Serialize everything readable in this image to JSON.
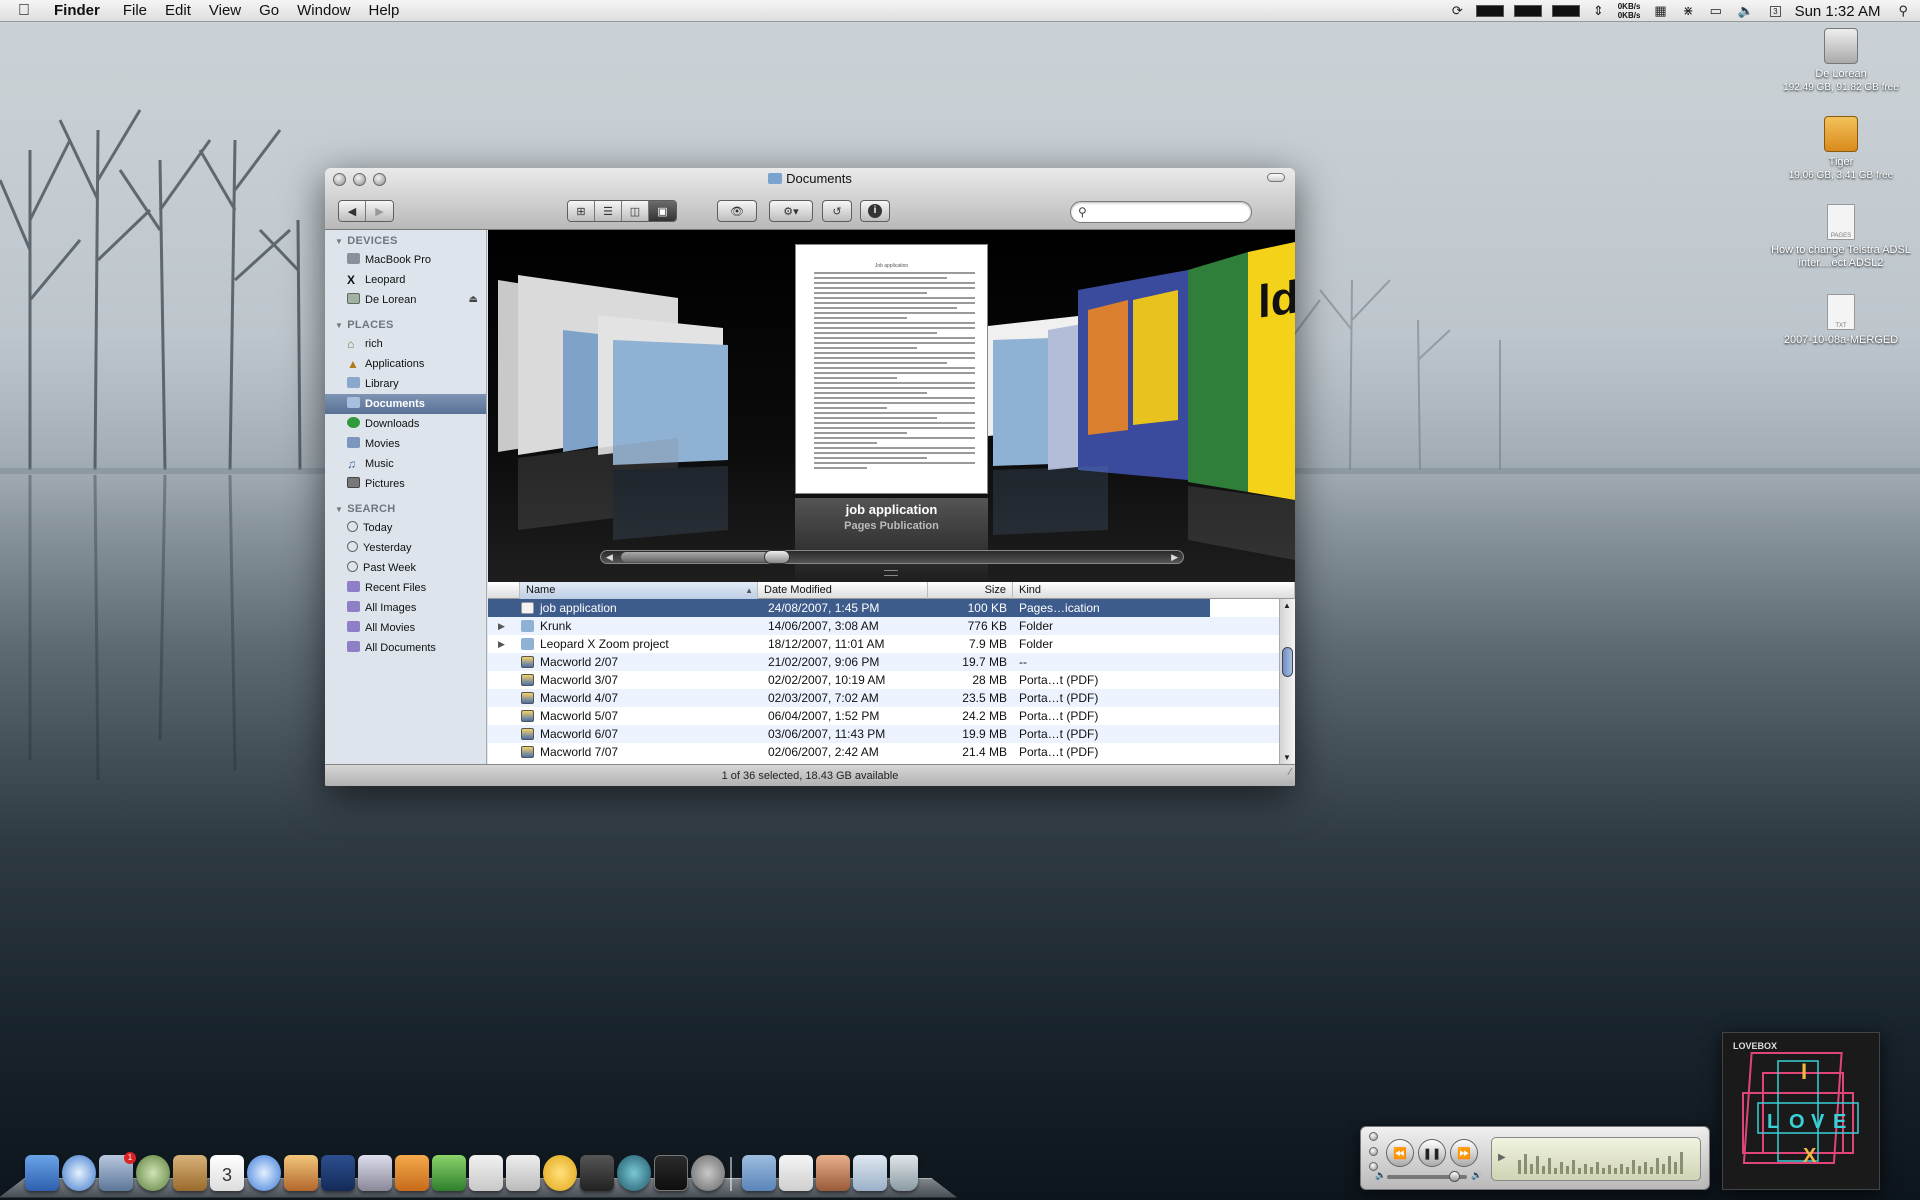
{
  "menubar": {
    "app_name": "Finder",
    "menus": [
      "File",
      "Edit",
      "View",
      "Go",
      "Window",
      "Help"
    ],
    "net_up": "0KB/s",
    "net_down": "0KB/s",
    "calendar_day": "3",
    "clock": "Sun 1:32 AM"
  },
  "desktop_icons": [
    {
      "name": "De Lorean",
      "sub": "192.49 GB, 91.82 GB free"
    },
    {
      "name": "Tiger",
      "sub": "19.06 GB, 3.41 GB free"
    },
    {
      "name": "How to change Telstra ADSL inter....ect ADSL2",
      "badge": "PAGES"
    },
    {
      "name": "2007-10-08a-MERGED",
      "badge": "TXT"
    }
  ],
  "window": {
    "title": "Documents",
    "search_placeholder": "",
    "status": "1 of 36 selected, 18.43 GB available"
  },
  "sidebar": {
    "devices_label": "DEVICES",
    "devices": [
      "MacBook Pro",
      "Leopard",
      "De Lorean"
    ],
    "places_label": "PLACES",
    "places": [
      "rich",
      "Applications",
      "Library",
      "Documents",
      "Downloads",
      "Movies",
      "Music",
      "Pictures"
    ],
    "search_label": "SEARCH",
    "searches": [
      "Today",
      "Yesterday",
      "Past Week",
      "Recent Files",
      "All Images",
      "All Movies",
      "All Documents"
    ],
    "selected": "Documents"
  },
  "coverflow": {
    "name": "job application",
    "kind": "Pages Publication",
    "doc_heading": "Job application",
    "right_cover_text": "ldd"
  },
  "list": {
    "columns": [
      "Name",
      "Date Modified",
      "Size",
      "Kind"
    ],
    "rows": [
      {
        "name": "job application",
        "date": "24/08/2007, 1:45 PM",
        "size": "100 KB",
        "kind": "Pages…ication",
        "selected": true,
        "folder": false,
        "expand": false
      },
      {
        "name": "Krunk",
        "date": "14/06/2007, 3:08 AM",
        "size": "776 KB",
        "kind": "Folder",
        "selected": false,
        "folder": true,
        "expand": true
      },
      {
        "name": "Leopard X Zoom project",
        "date": "18/12/2007, 11:01 AM",
        "size": "7.9 MB",
        "kind": "Folder",
        "selected": false,
        "folder": true,
        "expand": true
      },
      {
        "name": "Macworld 2/07",
        "date": "21/02/2007, 9:06 PM",
        "size": "19.7 MB",
        "kind": "--",
        "selected": false,
        "folder": false,
        "expand": false
      },
      {
        "name": "Macworld 3/07",
        "date": "02/02/2007, 10:19 AM",
        "size": "28 MB",
        "kind": "Porta…t (PDF)",
        "selected": false,
        "folder": false,
        "expand": false
      },
      {
        "name": "Macworld 4/07",
        "date": "02/03/2007, 7:02 AM",
        "size": "23.5 MB",
        "kind": "Porta…t (PDF)",
        "selected": false,
        "folder": false,
        "expand": false
      },
      {
        "name": "Macworld 5/07",
        "date": "06/04/2007, 1:52 PM",
        "size": "24.2 MB",
        "kind": "Porta…t (PDF)",
        "selected": false,
        "folder": false,
        "expand": false
      },
      {
        "name": "Macworld 6/07",
        "date": "03/06/2007, 11:43 PM",
        "size": "19.9 MB",
        "kind": "Porta…t (PDF)",
        "selected": false,
        "folder": false,
        "expand": false
      },
      {
        "name": "Macworld 7/07",
        "date": "02/06/2007, 2:42 AM",
        "size": "21.4 MB",
        "kind": "Porta…t (PDF)",
        "selected": false,
        "folder": false,
        "expand": false
      }
    ]
  },
  "album": {
    "label": "LOVEBOX",
    "letters": [
      "I",
      "L",
      "O",
      "V",
      "E",
      "X"
    ]
  },
  "icons": {
    "apple": "apple-icon",
    "search": "spotlight-icon"
  },
  "colors": {
    "selection": "#3d5b8b",
    "sidebar": "#dde4ec",
    "sidebar_selected": "#5a7196"
  }
}
